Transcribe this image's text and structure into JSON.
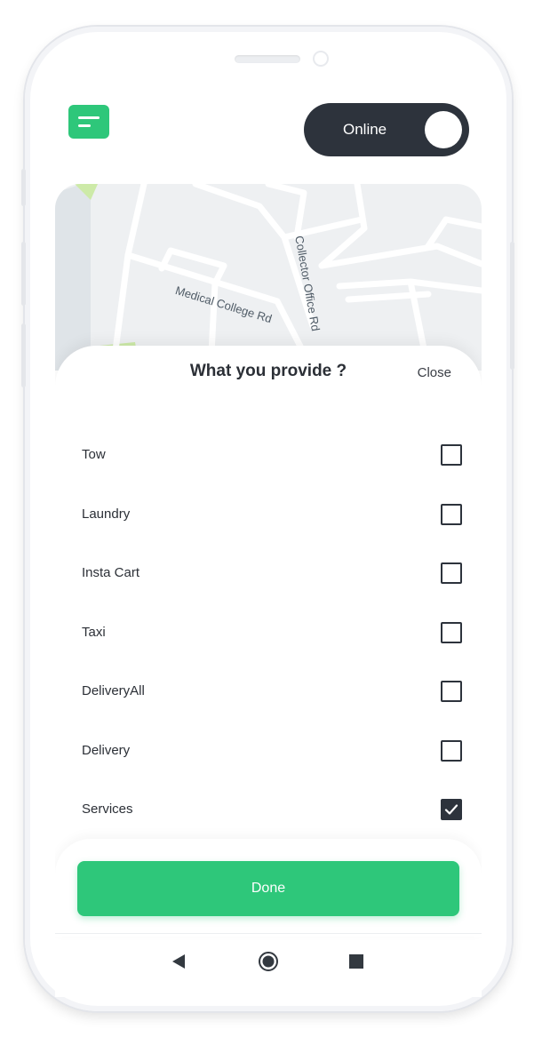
{
  "header": {
    "menu_icon": "menu-icon",
    "status_label": "Online",
    "status_on": true
  },
  "map": {
    "labels": [
      "Medical College Rd",
      "Collector Office Rd"
    ]
  },
  "sheet": {
    "title": "What you provide ?",
    "close_label": "Close",
    "options": [
      {
        "label": "Tow",
        "checked": false
      },
      {
        "label": "Laundry",
        "checked": false
      },
      {
        "label": "Insta Cart",
        "checked": false
      },
      {
        "label": "Taxi",
        "checked": false
      },
      {
        "label": "DeliveryAll",
        "checked": false
      },
      {
        "label": "Delivery",
        "checked": false
      },
      {
        "label": "Services",
        "checked": true
      }
    ],
    "done_label": "Done"
  },
  "colors": {
    "accent": "#2ec77a",
    "dark": "#2d333c"
  },
  "nav": {
    "back_icon": "back-icon",
    "home_icon": "home-icon",
    "recent_icon": "recent-apps-icon"
  }
}
